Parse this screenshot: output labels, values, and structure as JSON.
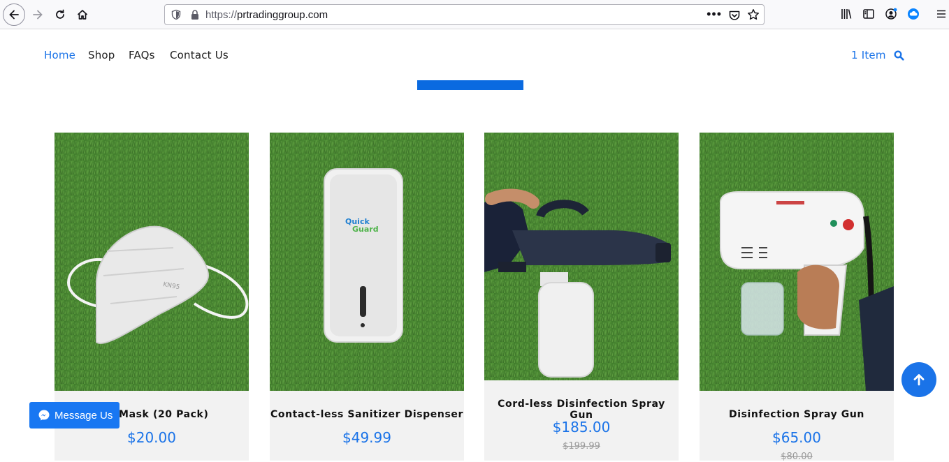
{
  "browser": {
    "url_scheme": "https://",
    "url_host": "prtradinggroup.com",
    "more_icon": "•••"
  },
  "nav": {
    "items": [
      {
        "label": "Home",
        "active": true
      },
      {
        "label": "Shop",
        "active": false
      },
      {
        "label": "FAQs",
        "active": false
      },
      {
        "label": "Contact Us",
        "active": false
      }
    ],
    "cart_label": "1 Item",
    "search_icon": "search-icon",
    "accent_color": "#1a73e8"
  },
  "products": [
    {
      "name": "ace Mask (20 Pack)",
      "price": "$20.00",
      "old_price": "",
      "image": "kn95-mask",
      "brand_text": "KN95"
    },
    {
      "name": "Contact-less Sanitizer Dispenser",
      "price": "$49.99",
      "old_price": "",
      "image": "sanitizer-dispenser",
      "brand_text_1": "Quick",
      "brand_text_2": "Guard"
    },
    {
      "name": "Cord-less Disinfection Spray Gun",
      "price": "$185.00",
      "old_price": "$199.99",
      "image": "cordless-spray-gun"
    },
    {
      "name": "Disinfection Spray Gun",
      "price": "$65.00",
      "old_price": "$80.00",
      "image": "spray-gun"
    }
  ],
  "messenger": {
    "label": "Message Us",
    "icon": "messenger-icon"
  },
  "scroll_top": {
    "icon": "arrow-up-icon"
  }
}
